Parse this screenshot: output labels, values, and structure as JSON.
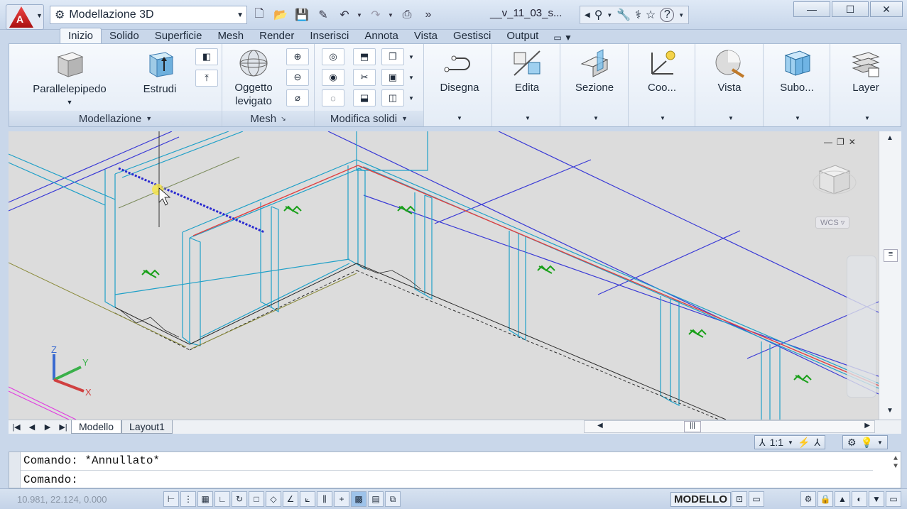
{
  "app": {
    "workspace": "Modellazione 3D",
    "document_title": "__v_11_03_s...",
    "colors": {
      "accent": "#d42a2a",
      "ribbon_bg": "#eef3f9",
      "viewport_bg": "#dcdcdc",
      "wire_cyan": "#1fa0c8",
      "wire_blue": "#3a3ad6",
      "wire_red": "#e04040",
      "hatch_green": "#1aa01a"
    }
  },
  "ribbon": {
    "tabs": [
      "Inizio",
      "Solido",
      "Superficie",
      "Mesh",
      "Render",
      "Inserisci",
      "Annota",
      "Vista",
      "Gestisci",
      "Output"
    ],
    "active_tab": "Inizio",
    "panels": {
      "modellazione": {
        "title": "Modellazione",
        "buttons": [
          "Parallelepipedo",
          "Estrudi"
        ]
      },
      "mesh": {
        "title": "Mesh",
        "buttons": [
          "Oggetto",
          "levigato"
        ]
      },
      "modifica_solidi": {
        "title": "Modifica solidi"
      },
      "disegna": {
        "title": "Disegna"
      },
      "edita": {
        "title": "Edita"
      },
      "sezione": {
        "title": "Sezione"
      },
      "coo": {
        "title": "Coo..."
      },
      "vista": {
        "title": "Vista"
      },
      "subo": {
        "title": "Subo..."
      },
      "layer": {
        "title": "Layer"
      }
    }
  },
  "viewport": {
    "viewcube_label": "WCS",
    "ucs": {
      "z": "Z",
      "y": "Y",
      "x": "X"
    }
  },
  "layout_tabs": [
    "Modello",
    "Layout1"
  ],
  "annotation": {
    "scale": "1:1"
  },
  "command": {
    "history": "Comando:  *Annullato*",
    "prompt": "Comando:"
  },
  "status": {
    "coordinates": "10.981, 22.124, 0.000",
    "space": "MODELLO"
  }
}
